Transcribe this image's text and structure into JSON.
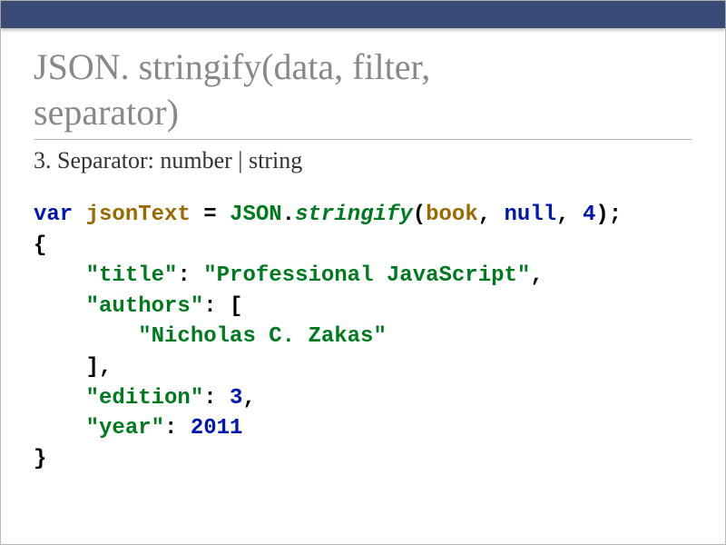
{
  "heading": {
    "line1": "JSON. stringify(data, filter,",
    "line2": "separator)"
  },
  "subtitle": "3. Separator: number | string",
  "code": {
    "var": "var",
    "ident": "jsonText",
    "eq": " = ",
    "json": "JSON",
    "dot": ".",
    "fn": "stringify",
    "lp": "(",
    "arg1": "book",
    "c1": ", ",
    "null": "null",
    "c2": ", ",
    "spaces": "4",
    "rp": ");",
    "brace_open": "{",
    "k_title": "\"title\"",
    "colon": ": ",
    "v_title": "\"Professional JavaScript\"",
    "comma": ",",
    "k_authors": "\"authors\"",
    "arr_open": "[",
    "v_author": "\"Nicholas C. Zakas\"",
    "arr_close": "]",
    "k_edition": "\"edition\"",
    "v_edition": "3",
    "k_year": "\"year\"",
    "v_year": "2011",
    "brace_close": "}"
  }
}
